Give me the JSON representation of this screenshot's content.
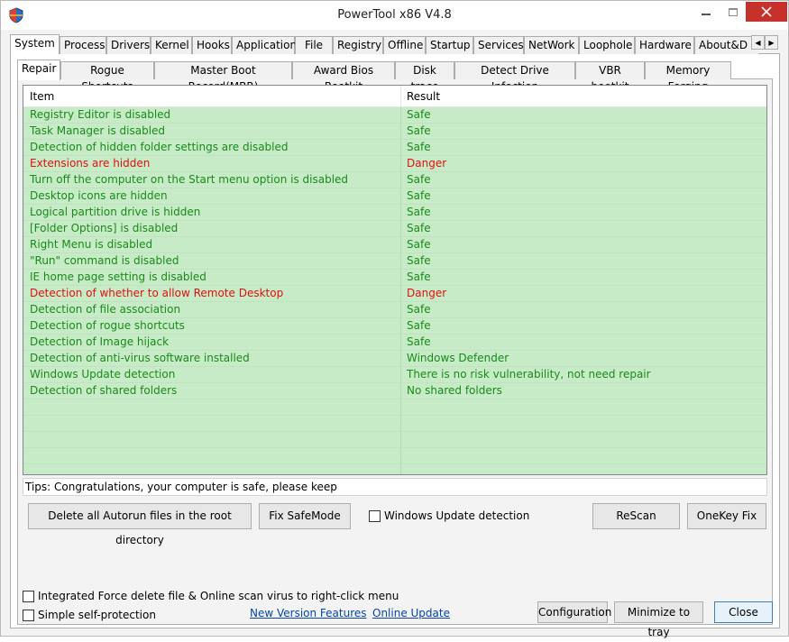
{
  "window": {
    "title": "PowerTool x86 V4.8"
  },
  "top_tabs": [
    {
      "label": "System",
      "active": true
    },
    {
      "label": "Process"
    },
    {
      "label": "Drivers"
    },
    {
      "label": "Kernel"
    },
    {
      "label": "Hooks"
    },
    {
      "label": "Application"
    },
    {
      "label": "File"
    },
    {
      "label": "Registry"
    },
    {
      "label": "Offline"
    },
    {
      "label": "Startup"
    },
    {
      "label": "Services"
    },
    {
      "label": "NetWork"
    },
    {
      "label": "Loophole"
    },
    {
      "label": "Hardware"
    },
    {
      "label": "About&D"
    }
  ],
  "sub_tabs": [
    {
      "label": "Repair",
      "active": true
    },
    {
      "label": "Rogue Shortcuts"
    },
    {
      "label": "Master Boot Record(MBR)"
    },
    {
      "label": "Award Bios Rootkit"
    },
    {
      "label": "Disk trace"
    },
    {
      "label": "Detect Drive Infection"
    },
    {
      "label": "VBR bootkit"
    },
    {
      "label": "Memory Forging"
    }
  ],
  "list": {
    "headers": {
      "item": "Item",
      "result": "Result"
    },
    "rows": [
      {
        "item": "Registry Editor is disabled",
        "result": "Safe",
        "status": "safe"
      },
      {
        "item": "Task Manager is disabled",
        "result": "Safe",
        "status": "safe"
      },
      {
        "item": "Detection of hidden folder settings are disabled",
        "result": "Safe",
        "status": "safe"
      },
      {
        "item": "Extensions are hidden",
        "result": "Danger",
        "status": "danger"
      },
      {
        "item": "Turn off the computer on the Start menu option is disabled",
        "result": "Safe",
        "status": "safe"
      },
      {
        "item": "Desktop icons are hidden",
        "result": "Safe",
        "status": "safe"
      },
      {
        "item": "Logical partition drive is hidden",
        "result": "Safe",
        "status": "safe"
      },
      {
        "item": "[Folder Options] is disabled",
        "result": "Safe",
        "status": "safe"
      },
      {
        "item": "Right Menu is disabled",
        "result": "Safe",
        "status": "safe"
      },
      {
        "item": "\"Run\" command is disabled",
        "result": "Safe",
        "status": "safe"
      },
      {
        "item": "IE home page setting is disabled",
        "result": "Safe",
        "status": "safe"
      },
      {
        "item": "Detection of whether to allow Remote Desktop",
        "result": "Danger",
        "status": "danger"
      },
      {
        "item": "Detection of file association",
        "result": "Safe",
        "status": "safe"
      },
      {
        "item": "Detection of rogue shortcuts",
        "result": "Safe",
        "status": "safe"
      },
      {
        "item": "Detection of Image hijack",
        "result": "Safe",
        "status": "safe"
      },
      {
        "item": "Detection of anti-virus software installed",
        "result": "Windows Defender",
        "status": "safe"
      },
      {
        "item": "Windows Update detection",
        "result": "There is no risk vulnerability, not need repair",
        "status": "safe"
      },
      {
        "item": "Detection of shared folders",
        "result": "No shared folders",
        "status": "safe"
      }
    ]
  },
  "tips": "Tips: Congratulations, your computer is safe, please keep",
  "actions": {
    "delete_autorun": "Delete all Autorun files in the root directory",
    "fix_safemode": "Fix SafeMode",
    "windows_update_check": "Windows Update detection",
    "rescan": "ReScan",
    "onekey_fix": "OneKey Fix"
  },
  "footer": {
    "integrated_check": "Integrated Force delete file & Online scan virus to right-click menu",
    "self_protection_check": "Simple self-protection",
    "new_version_link": "New Version Features",
    "online_update_link": "Online Update",
    "configuration": "Configuration",
    "minimize_tray": "Minimize to tray",
    "close": "Close"
  },
  "colors": {
    "safe": "#1a8a1a",
    "danger": "#e01010",
    "row_bg": "#c7ebc7",
    "close_caption": "#c7312b"
  }
}
